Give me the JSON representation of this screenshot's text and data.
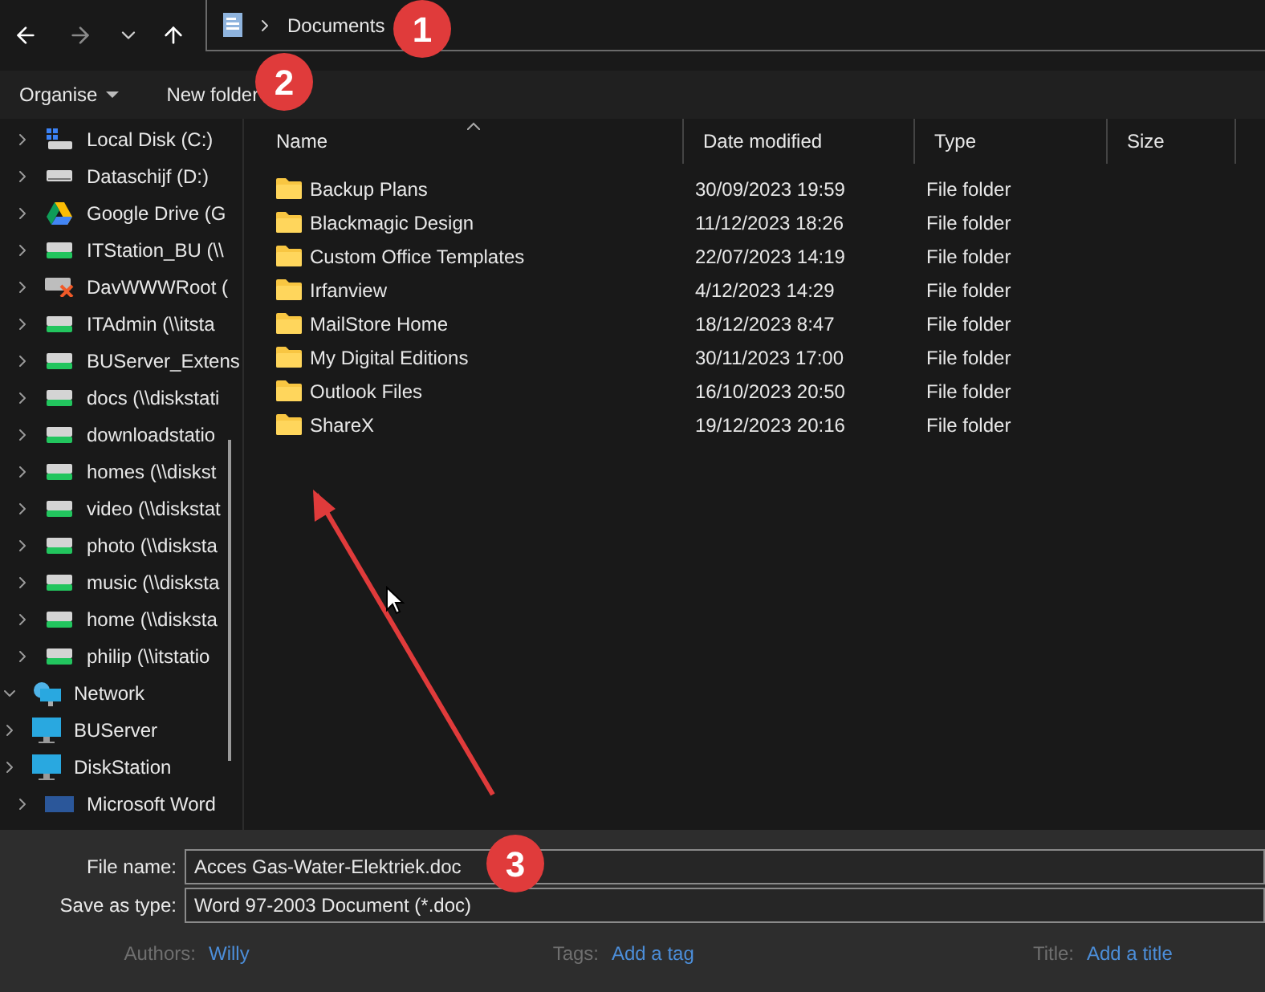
{
  "address_bar": {
    "path": [
      {
        "label": "Documents"
      }
    ]
  },
  "toolbar": {
    "organise": "Organise",
    "new_folder": "New folder"
  },
  "sidebar": {
    "items": [
      {
        "label": "Local Disk (C:)",
        "kind": "local",
        "expanded": false
      },
      {
        "label": "Dataschijf (D:)",
        "kind": "drive",
        "expanded": false
      },
      {
        "label": "Google Drive (G",
        "kind": "cloud",
        "expanded": false
      },
      {
        "label": "ITStation_BU (\\\\",
        "kind": "netdrive",
        "expanded": false
      },
      {
        "label": "DavWWWRoot (",
        "kind": "disconnected",
        "expanded": false
      },
      {
        "label": "ITAdmin (\\\\itsta",
        "kind": "netdrive",
        "expanded": false
      },
      {
        "label": "BUServer_Extens",
        "kind": "netdrive",
        "expanded": false
      },
      {
        "label": "docs (\\\\diskstati",
        "kind": "netdrive",
        "expanded": false
      },
      {
        "label": "downloadstatio",
        "kind": "netdrive",
        "expanded": false
      },
      {
        "label": "homes (\\\\diskst",
        "kind": "netdrive",
        "expanded": false
      },
      {
        "label": "video (\\\\diskstat",
        "kind": "netdrive",
        "expanded": false
      },
      {
        "label": "photo (\\\\disksta",
        "kind": "netdrive",
        "expanded": false
      },
      {
        "label": "music (\\\\disksta",
        "kind": "netdrive",
        "expanded": false
      },
      {
        "label": "home (\\\\disksta",
        "kind": "netdrive",
        "expanded": false
      },
      {
        "label": "philip (\\\\itstatio",
        "kind": "netdrive",
        "expanded": false
      },
      {
        "label": "Network",
        "kind": "network",
        "expanded": true,
        "children": [
          {
            "label": "BUServer",
            "kind": "computer",
            "expanded": false
          },
          {
            "label": "DiskStation",
            "kind": "computer",
            "expanded": false
          }
        ]
      },
      {
        "label": "Microsoft Word",
        "kind": "word",
        "expanded": false
      }
    ]
  },
  "table": {
    "columns": [
      "Name",
      "Date modified",
      "Type",
      "Size"
    ],
    "rows": [
      {
        "name": "Backup Plans",
        "date": "30/09/2023 19:59",
        "type": "File folder"
      },
      {
        "name": "Blackmagic Design",
        "date": "11/12/2023 18:26",
        "type": "File folder"
      },
      {
        "name": "Custom Office Templates",
        "date": "22/07/2023 14:19",
        "type": "File folder"
      },
      {
        "name": "Irfanview",
        "date": "4/12/2023 14:29",
        "type": "File folder"
      },
      {
        "name": "MailStore Home",
        "date": "18/12/2023 8:47",
        "type": "File folder"
      },
      {
        "name": "My Digital Editions",
        "date": "30/11/2023 17:00",
        "type": "File folder"
      },
      {
        "name": "Outlook Files",
        "date": "16/10/2023 20:50",
        "type": "File folder"
      },
      {
        "name": "ShareX",
        "date": "19/12/2023 20:16",
        "type": "File folder"
      }
    ]
  },
  "form": {
    "file_name": {
      "label": "File name:",
      "value": "Acces Gas-Water-Elektriek.doc"
    },
    "save_as_type": {
      "label": "Save as type:",
      "value": "Word 97-2003 Document (*.doc)"
    },
    "meta": [
      {
        "label": "Authors:",
        "value": "Willy"
      },
      {
        "label": "Tags:",
        "value": "Add a tag"
      },
      {
        "label": "Title:",
        "value": "Add a title"
      }
    ]
  },
  "annotations": [
    {
      "label": "1"
    },
    {
      "label": "2"
    },
    {
      "label": "3"
    }
  ]
}
